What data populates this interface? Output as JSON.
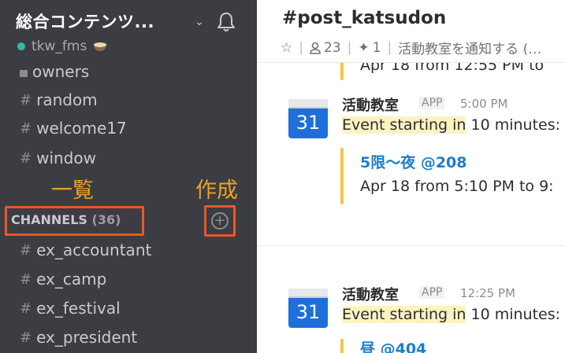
{
  "sidebar": {
    "team_name": "総合コンテンツ...",
    "username": "tkw_fms",
    "channels_top": [
      {
        "label": "owners",
        "private": true
      },
      {
        "label": "random",
        "private": false
      },
      {
        "label": "welcome17",
        "private": false
      },
      {
        "label": "window",
        "private": false
      }
    ],
    "section_label": "CHANNELS",
    "section_count": "(36)",
    "channels": [
      {
        "label": "ex_accountant"
      },
      {
        "label": "ex_camp"
      },
      {
        "label": "ex_festival"
      },
      {
        "label": "ex_president"
      }
    ],
    "annotations": {
      "list": "一覧",
      "create": "作成"
    },
    "colors": {
      "bg": "#3b3d43",
      "annotation": "#f0a020",
      "highlight_box": "#e8582a",
      "presence": "#35b9a0"
    }
  },
  "header": {
    "title": "#post_katsudon",
    "members": "23",
    "pinned": "1",
    "topic": "活動教室を通知する (…"
  },
  "messages": [
    {
      "partial_text": "Apr 18 from 12:55 PM to",
      "sender": "活動教室",
      "app_badge": "APP",
      "time": "5:00 PM",
      "icon_day": "31",
      "text_highlight": "Event starting in",
      "text_rest": " 10 minutes:",
      "attachment_title": "5限〜夜 @208",
      "attachment_text": "Apr 18 from 5:10 PM to 9:"
    },
    {
      "sender": "活動教室",
      "app_badge": "APP",
      "time": "12:25 PM",
      "icon_day": "31",
      "text_highlight": "Event starting in",
      "text_rest": " 10 minutes:",
      "attachment_title": "昼 @404"
    }
  ]
}
